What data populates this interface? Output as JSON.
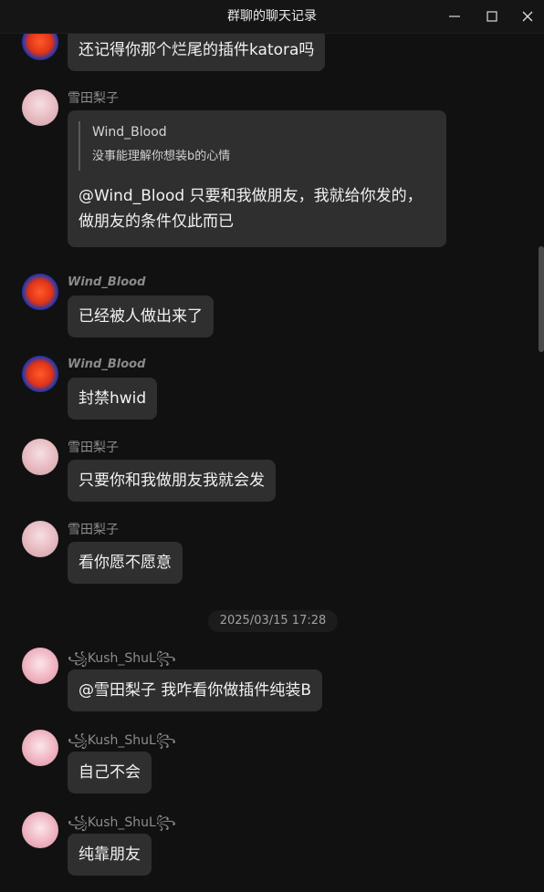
{
  "window": {
    "title": "群聊的聊天记录"
  },
  "colors": {
    "background": "#111111",
    "bubble": "#2f2f2f",
    "sender": "#8c8c8c"
  },
  "messages": [
    {
      "sender": "",
      "avatar": "wind-blood-avatar",
      "text": "还记得你那个烂尾的插件katora吗"
    },
    {
      "sender": "雪田梨子",
      "avatar": "pink-hair-avatar",
      "quote": {
        "author": "Wind_Blood",
        "text": "没事能理解你想装b的心情"
      },
      "text_line1": "@Wind_Blood 只要和我做朋友，我就给你发的，",
      "text_line2": "做朋友的条件仅此而已"
    },
    {
      "sender": "Wind_Blood",
      "avatar": "wind-blood-avatar",
      "text": "已经被人做出来了"
    },
    {
      "sender": "Wind_Blood",
      "avatar": "wind-blood-avatar",
      "text": "封禁hwid"
    },
    {
      "sender": "雪田梨子",
      "avatar": "pink-hair-avatar",
      "text": "只要你和我做朋友我就会发"
    },
    {
      "sender": "雪田梨子",
      "avatar": "pink-hair-avatar",
      "text": "看你愿不愿意"
    },
    {
      "sender": "꧁Kush_ShuL꧂",
      "avatar": "kush-avatar",
      "text": "@雪田梨子 我咋看你做插件纯装B"
    },
    {
      "sender": "꧁Kush_ShuL꧂",
      "avatar": "kush-avatar",
      "text": "自己不会"
    },
    {
      "sender": "꧁Kush_ShuL꧂",
      "avatar": "kush-avatar",
      "text": "纯靠朋友"
    }
  ],
  "timestamp": "2025/03/15 17:28"
}
